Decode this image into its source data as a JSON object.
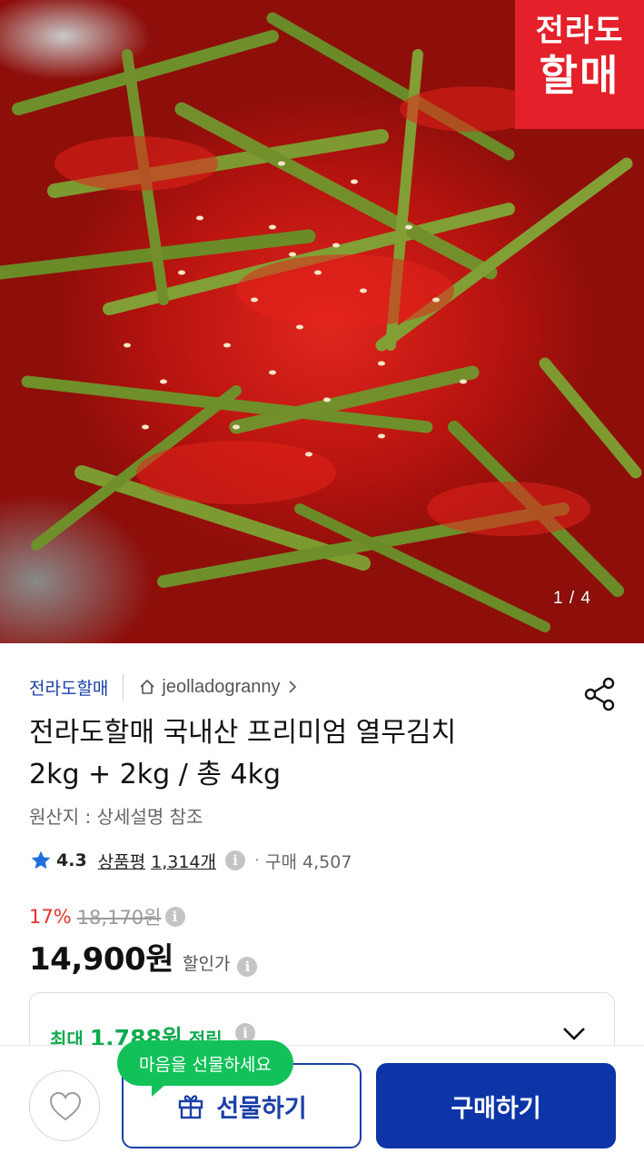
{
  "hero": {
    "brand_stamp_line1": "전라도",
    "brand_stamp_line2": "할매",
    "image_counter": "1 / 4"
  },
  "seller": {
    "name": "전라도할매",
    "store_id": "jeolladogranny"
  },
  "product": {
    "title_line1": "전라도할매 국내산 프리미엄 열무김치",
    "title_line2": "2kg + 2kg / 총 4kg",
    "origin": "원산지 : 상세설명 참조"
  },
  "rating": {
    "score": "4.3",
    "review_label": "상품평",
    "review_count": "1,314개",
    "purchase_label": "구매 4,507"
  },
  "price": {
    "discount_percent": "17%",
    "original_price": "18,170원",
    "sale_price": "14,900원",
    "sale_label": "할인가"
  },
  "points": {
    "prefix": "최대",
    "amount": "1,788원",
    "suffix": "적립"
  },
  "bottom_bar": {
    "gift_tooltip": "마음을 선물하세요",
    "gift_label": "선물하기",
    "buy_label": "구매하기"
  },
  "icons": {
    "home": "home-icon",
    "share": "share-icon",
    "star": "star-icon",
    "info": "info-icon",
    "heart": "heart-icon",
    "gift": "gift-icon",
    "chevron_down": "chevron-down-icon"
  },
  "colors": {
    "brand_blue": "#0d35a8",
    "seller_blue": "#1a3fa8",
    "discount_red": "#e8332c",
    "points_green": "#0eaa4f",
    "tooltip_green": "#12c259",
    "star_blue": "#1f6fe0"
  }
}
